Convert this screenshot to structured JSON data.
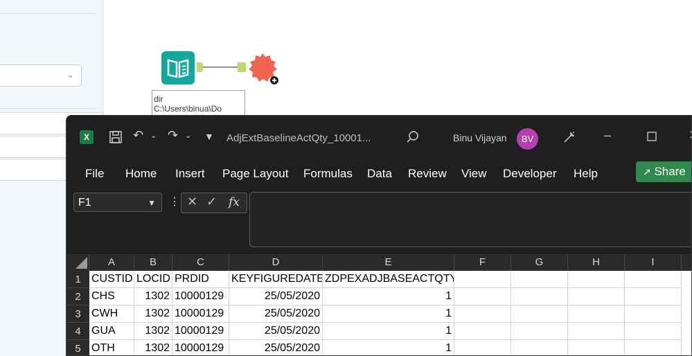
{
  "workflow": {
    "annotation_line1": "dir",
    "annotation_line2": "C:\\Users\\binua\\Do"
  },
  "excel": {
    "doc_title": "AdjExtBaselineActQty_10001...",
    "user_name": "Binu Vijayan",
    "user_initials": "BV",
    "menu": [
      "File",
      "Home",
      "Insert",
      "Page Layout",
      "Formulas",
      "Data",
      "Review",
      "View",
      "Developer",
      "Help"
    ],
    "share_label": "Share",
    "name_box": "F1",
    "fx_label": "fx",
    "columns": [
      "A",
      "B",
      "C",
      "D",
      "E",
      "F",
      "G",
      "H",
      "I"
    ],
    "rows": [
      {
        "num": "1",
        "cells": [
          "CUSTID",
          "LOCID",
          "PRDID",
          "KEYFIGUREDATE",
          "ZDPEXADJBASEACTQTY"
        ]
      },
      {
        "num": "2",
        "cells": [
          "CHS",
          "1302",
          "10000129",
          "25/05/2020",
          "1"
        ]
      },
      {
        "num": "3",
        "cells": [
          "CWH",
          "1302",
          "10000129",
          "25/05/2020",
          "1"
        ]
      },
      {
        "num": "4",
        "cells": [
          "GUA",
          "1302",
          "10000129",
          "25/05/2020",
          "1"
        ]
      },
      {
        "num": "5",
        "cells": [
          "OTH",
          "1302",
          "10000129",
          "25/05/2020",
          "1"
        ]
      }
    ],
    "accent_color": "#2e8b4d",
    "avatar_color": "#b53fb0"
  }
}
